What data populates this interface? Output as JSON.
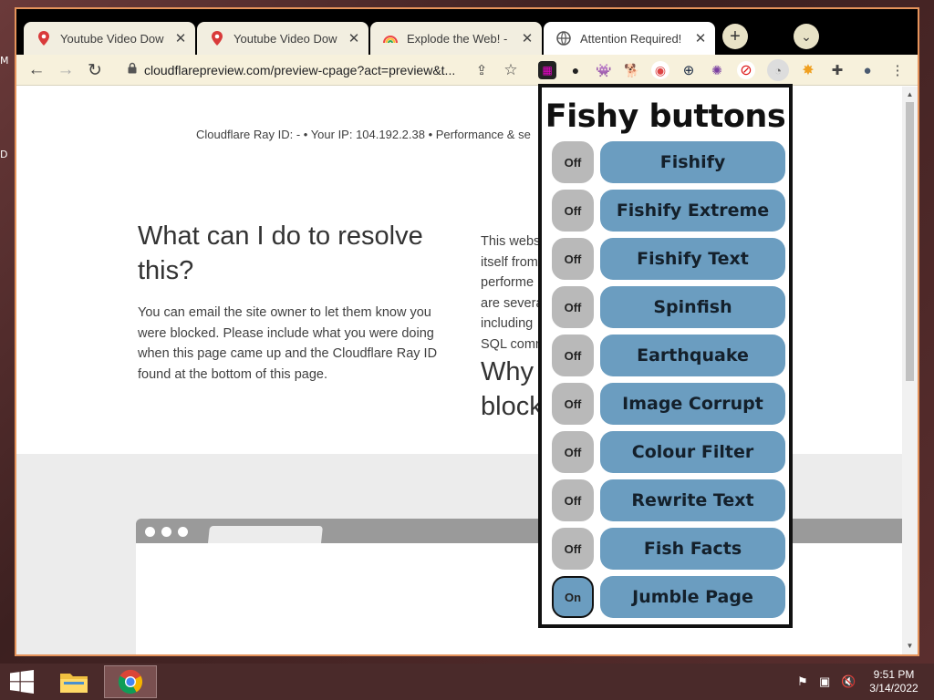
{
  "desktop": {
    "letters": [
      "M",
      "D"
    ]
  },
  "tabs": [
    {
      "title": "Youtube Video Download",
      "favicon": "map-pin-icon"
    },
    {
      "title": "Youtube Video Download",
      "favicon": "map-pin-icon"
    },
    {
      "title": "Explode the Web! - Chr",
      "favicon": "rainbow-icon"
    },
    {
      "title": "Attention Required! | Cl",
      "favicon": "globe-icon"
    }
  ],
  "toolbar": {
    "url": "cloudflarepreview.com/preview-cpage?act=preview&t..."
  },
  "page": {
    "footer_line": "Cloudflare Ray ID: -  •  Your IP: 104.192.2.38  •  Performance & se",
    "resolve_heading": "What can I do to resolve this?",
    "resolve_text": "You can email the site owner to let them know you were blocked. Please include what you were doing when this page came up and the Cloudflare Ray ID found at the bottom of this page.",
    "right_text_lines": [
      "This webs",
      "itself from",
      "performe",
      "are severa",
      "including",
      "SQL comn"
    ],
    "why_heading_lines": [
      "Why",
      "block"
    ]
  },
  "popup": {
    "title": "Fishy buttons",
    "rows": [
      {
        "state": "Off",
        "label": "Fishify"
      },
      {
        "state": "Off",
        "label": "Fishify Extreme"
      },
      {
        "state": "Off",
        "label": "Fishify Text"
      },
      {
        "state": "Off",
        "label": "Spinfish"
      },
      {
        "state": "Off",
        "label": "Earthquake"
      },
      {
        "state": "Off",
        "label": "Image Corrupt"
      },
      {
        "state": "Off",
        "label": "Colour Filter"
      },
      {
        "state": "Off",
        "label": "Rewrite Text"
      },
      {
        "state": "Off",
        "label": "Fish Facts"
      },
      {
        "state": "On",
        "label": "Jumble Page"
      }
    ]
  },
  "taskbar": {
    "time": "9:51 PM",
    "date": "3/14/2022"
  }
}
